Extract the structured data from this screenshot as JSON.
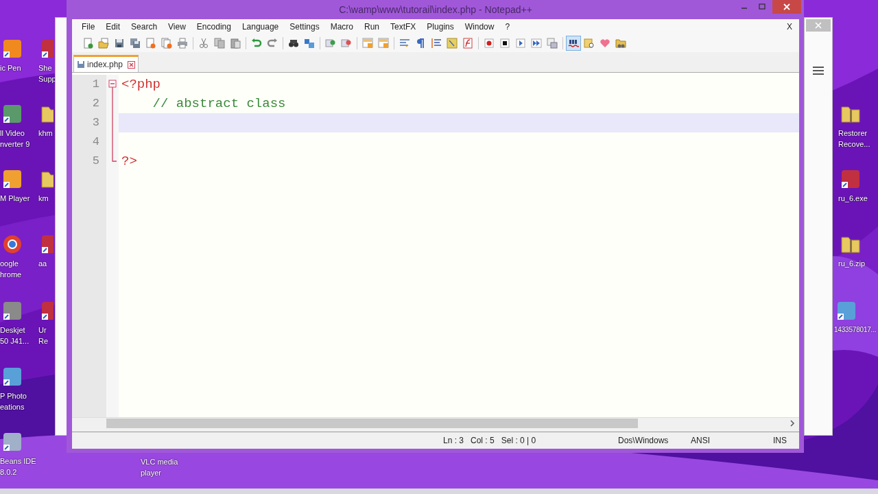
{
  "desktop_icons": [
    {
      "label": "ic Pen",
      "kind": "pen"
    },
    {
      "label": "ll Video\nnverter 9",
      "kind": "media"
    },
    {
      "label": "M Player",
      "kind": "player"
    },
    {
      "label": "oogle\nhrome",
      "kind": "browser"
    },
    {
      "label": "Deskjet\n50 J41...",
      "kind": "printer"
    },
    {
      "label": "P Photo\neations",
      "kind": "photo"
    },
    {
      "label": "Beans IDE\n8.0.2",
      "kind": "cube"
    },
    {
      "label": "She\nSupp",
      "kind": "app"
    },
    {
      "label": "khm",
      "kind": "folder"
    },
    {
      "label": "km",
      "kind": "folder"
    },
    {
      "label": "aa",
      "kind": "app"
    },
    {
      "label": "Ur\nRe",
      "kind": "app"
    },
    {
      "label": "VLC media\nplayer"
    },
    {
      "label": "Restorer\nRecove...",
      "kind": "zip"
    },
    {
      "label": "ru_6.exe",
      "kind": "app"
    },
    {
      "label": "ru_6.zip",
      "kind": "zip"
    },
    {
      "label": "1433578017...",
      "kind": "photo"
    }
  ],
  "window": {
    "title": "C:\\wamp\\www\\tutorail\\index.php - Notepad++"
  },
  "menu": [
    "File",
    "Edit",
    "Search",
    "View",
    "Encoding",
    "Language",
    "Settings",
    "Macro",
    "Run",
    "TextFX",
    "Plugins",
    "Window",
    "?"
  ],
  "menu_close": "X",
  "toolbar_groups": [
    [
      {
        "kind": "new",
        "on": false
      },
      {
        "kind": "open",
        "on": false
      },
      {
        "kind": "save",
        "on": false
      },
      {
        "kind": "save-all",
        "on": false
      },
      {
        "kind": "close",
        "on": false
      },
      {
        "kind": "close-all",
        "on": false
      },
      {
        "kind": "print",
        "on": false
      }
    ],
    [
      {
        "kind": "cut",
        "on": false
      },
      {
        "kind": "copy",
        "on": false
      },
      {
        "kind": "paste",
        "on": false
      }
    ],
    [
      {
        "kind": "undo",
        "on": false
      },
      {
        "kind": "redo",
        "on": false
      }
    ],
    [
      {
        "kind": "find",
        "on": false
      },
      {
        "kind": "replace",
        "on": false
      }
    ],
    [
      {
        "kind": "zoom-in",
        "on": false
      },
      {
        "kind": "zoom-out",
        "on": false
      }
    ],
    [
      {
        "kind": "sync",
        "on": false
      },
      {
        "kind": "sync",
        "on": false
      }
    ],
    [
      {
        "kind": "wrap",
        "on": false
      },
      {
        "kind": "pilcrow",
        "on": false
      },
      {
        "kind": "indent",
        "on": false
      },
      {
        "kind": "note",
        "on": false
      },
      {
        "kind": "function",
        "on": false
      }
    ],
    [
      {
        "kind": "record",
        "on": false
      },
      {
        "kind": "stop",
        "on": false
      },
      {
        "kind": "play",
        "on": false
      },
      {
        "kind": "play-multi",
        "on": false
      },
      {
        "kind": "save-macro",
        "on": false
      }
    ],
    [
      {
        "kind": "spellcheck",
        "on": true
      },
      {
        "kind": "doc-find",
        "on": false
      },
      {
        "kind": "heart",
        "on": false
      },
      {
        "kind": "folder",
        "on": false
      }
    ]
  ],
  "tabs": [
    {
      "label": "index.php",
      "selected": true
    }
  ],
  "code_lines": [
    {
      "number": "1",
      "kind": "fold-start",
      "current": false,
      "tokens": [
        {
          "kind": "tag",
          "text": "<?php"
        }
      ]
    },
    {
      "number": "2",
      "kind": "fold-middle",
      "current": false,
      "tokens": [
        {
          "kind": "comment",
          "text": "    // abstract class"
        }
      ]
    },
    {
      "number": "3",
      "kind": "fold-middle",
      "current": true
    },
    {
      "number": "4",
      "kind": "fold-middle",
      "current": false
    },
    {
      "number": "5",
      "kind": "fold-end",
      "current": false,
      "tokens": [
        {
          "kind": "tag",
          "text": "?>"
        }
      ]
    }
  ],
  "status_bar": {
    "position": [
      "Ln : 3",
      "Col : 5",
      "Sel : 0 | 0"
    ],
    "eol": "Dos\\Windows",
    "encoding": "ANSI",
    "mode": "INS"
  }
}
